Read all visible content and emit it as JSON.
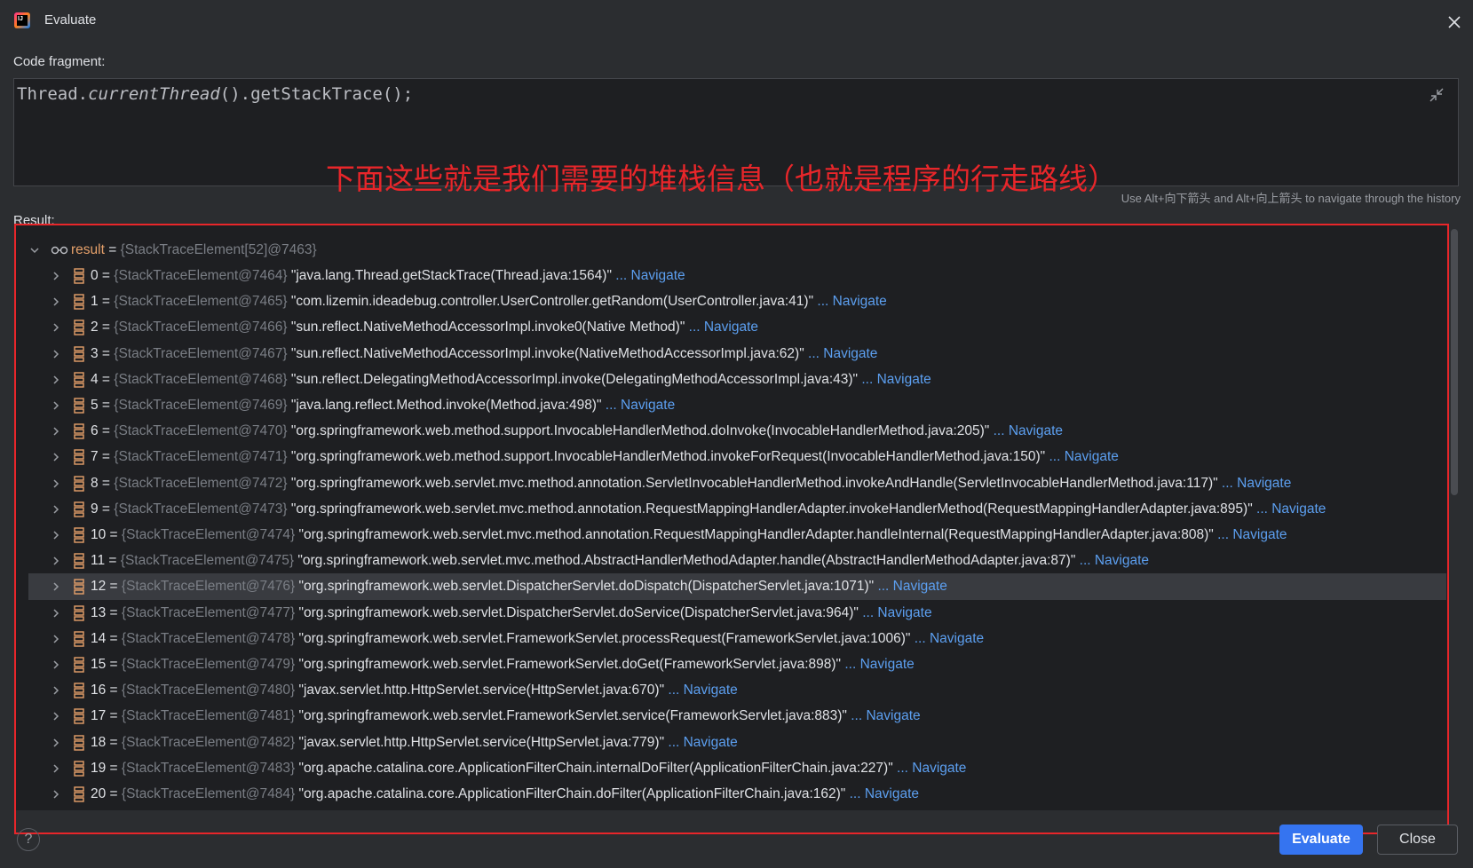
{
  "window": {
    "title": "Evaluate"
  },
  "code": {
    "label": "Code fragment:",
    "prefix": "Thread.",
    "italic": "currentThread",
    "suffix": "().getStackTrace();"
  },
  "annotation": "下面这些就是我们需要的堆栈信息（也就是程序的行走路线）",
  "history_hint": "Use Alt+向下箭头 and Alt+向上箭头 to navigate through the history",
  "result": {
    "label": "Result:",
    "root_name": "result",
    "root_value": "{StackTraceElement[52]@7463}",
    "nav_label": "... Navigate",
    "rows": [
      {
        "idx": "0",
        "type": "{StackTraceElement@7464}",
        "value": "\"java.lang.Thread.getStackTrace(Thread.java:1564)\""
      },
      {
        "idx": "1",
        "type": "{StackTraceElement@7465}",
        "value": "\"com.lizemin.ideadebug.controller.UserController.getRandom(UserController.java:41)\""
      },
      {
        "idx": "2",
        "type": "{StackTraceElement@7466}",
        "value": "\"sun.reflect.NativeMethodAccessorImpl.invoke0(Native Method)\""
      },
      {
        "idx": "3",
        "type": "{StackTraceElement@7467}",
        "value": "\"sun.reflect.NativeMethodAccessorImpl.invoke(NativeMethodAccessorImpl.java:62)\""
      },
      {
        "idx": "4",
        "type": "{StackTraceElement@7468}",
        "value": "\"sun.reflect.DelegatingMethodAccessorImpl.invoke(DelegatingMethodAccessorImpl.java:43)\""
      },
      {
        "idx": "5",
        "type": "{StackTraceElement@7469}",
        "value": "\"java.lang.reflect.Method.invoke(Method.java:498)\""
      },
      {
        "idx": "6",
        "type": "{StackTraceElement@7470}",
        "value": "\"org.springframework.web.method.support.InvocableHandlerMethod.doInvoke(InvocableHandlerMethod.java:205)\""
      },
      {
        "idx": "7",
        "type": "{StackTraceElement@7471}",
        "value": "\"org.springframework.web.method.support.InvocableHandlerMethod.invokeForRequest(InvocableHandlerMethod.java:150)\""
      },
      {
        "idx": "8",
        "type": "{StackTraceElement@7472}",
        "value": "\"org.springframework.web.servlet.mvc.method.annotation.ServletInvocableHandlerMethod.invokeAndHandle(ServletInvocableHandlerMethod.java:117)\""
      },
      {
        "idx": "9",
        "type": "{StackTraceElement@7473}",
        "value": "\"org.springframework.web.servlet.mvc.method.annotation.RequestMappingHandlerAdapter.invokeHandlerMethod(RequestMappingHandlerAdapter.java:895)\""
      },
      {
        "idx": "10",
        "type": "{StackTraceElement@7474}",
        "value": "\"org.springframework.web.servlet.mvc.method.annotation.RequestMappingHandlerAdapter.handleInternal(RequestMappingHandlerAdapter.java:808)\""
      },
      {
        "idx": "11",
        "type": "{StackTraceElement@7475}",
        "value": "\"org.springframework.web.servlet.mvc.method.AbstractHandlerMethodAdapter.handle(AbstractHandlerMethodAdapter.java:87)\""
      },
      {
        "idx": "12",
        "type": "{StackTraceElement@7476}",
        "value": "\"org.springframework.web.servlet.DispatcherServlet.doDispatch(DispatcherServlet.java:1071)\"",
        "selected": true
      },
      {
        "idx": "13",
        "type": "{StackTraceElement@7477}",
        "value": "\"org.springframework.web.servlet.DispatcherServlet.doService(DispatcherServlet.java:964)\""
      },
      {
        "idx": "14",
        "type": "{StackTraceElement@7478}",
        "value": "\"org.springframework.web.servlet.FrameworkServlet.processRequest(FrameworkServlet.java:1006)\""
      },
      {
        "idx": "15",
        "type": "{StackTraceElement@7479}",
        "value": "\"org.springframework.web.servlet.FrameworkServlet.doGet(FrameworkServlet.java:898)\""
      },
      {
        "idx": "16",
        "type": "{StackTraceElement@7480}",
        "value": "\"javax.servlet.http.HttpServlet.service(HttpServlet.java:670)\""
      },
      {
        "idx": "17",
        "type": "{StackTraceElement@7481}",
        "value": "\"org.springframework.web.servlet.FrameworkServlet.service(FrameworkServlet.java:883)\""
      },
      {
        "idx": "18",
        "type": "{StackTraceElement@7482}",
        "value": "\"javax.servlet.http.HttpServlet.service(HttpServlet.java:779)\""
      },
      {
        "idx": "19",
        "type": "{StackTraceElement@7483}",
        "value": "\"org.apache.catalina.core.ApplicationFilterChain.internalDoFilter(ApplicationFilterChain.java:227)\""
      },
      {
        "idx": "20",
        "type": "{StackTraceElement@7484}",
        "value": "\"org.apache.catalina.core.ApplicationFilterChain.doFilter(ApplicationFilterChain.java:162)\""
      }
    ]
  },
  "buttons": {
    "help": "?",
    "evaluate": "Evaluate",
    "close": "Close"
  },
  "colors": {
    "accent": "#3574f0",
    "annotation": "#e8262a",
    "navigate": "#5c9ff0",
    "background": "#2b2d30"
  }
}
